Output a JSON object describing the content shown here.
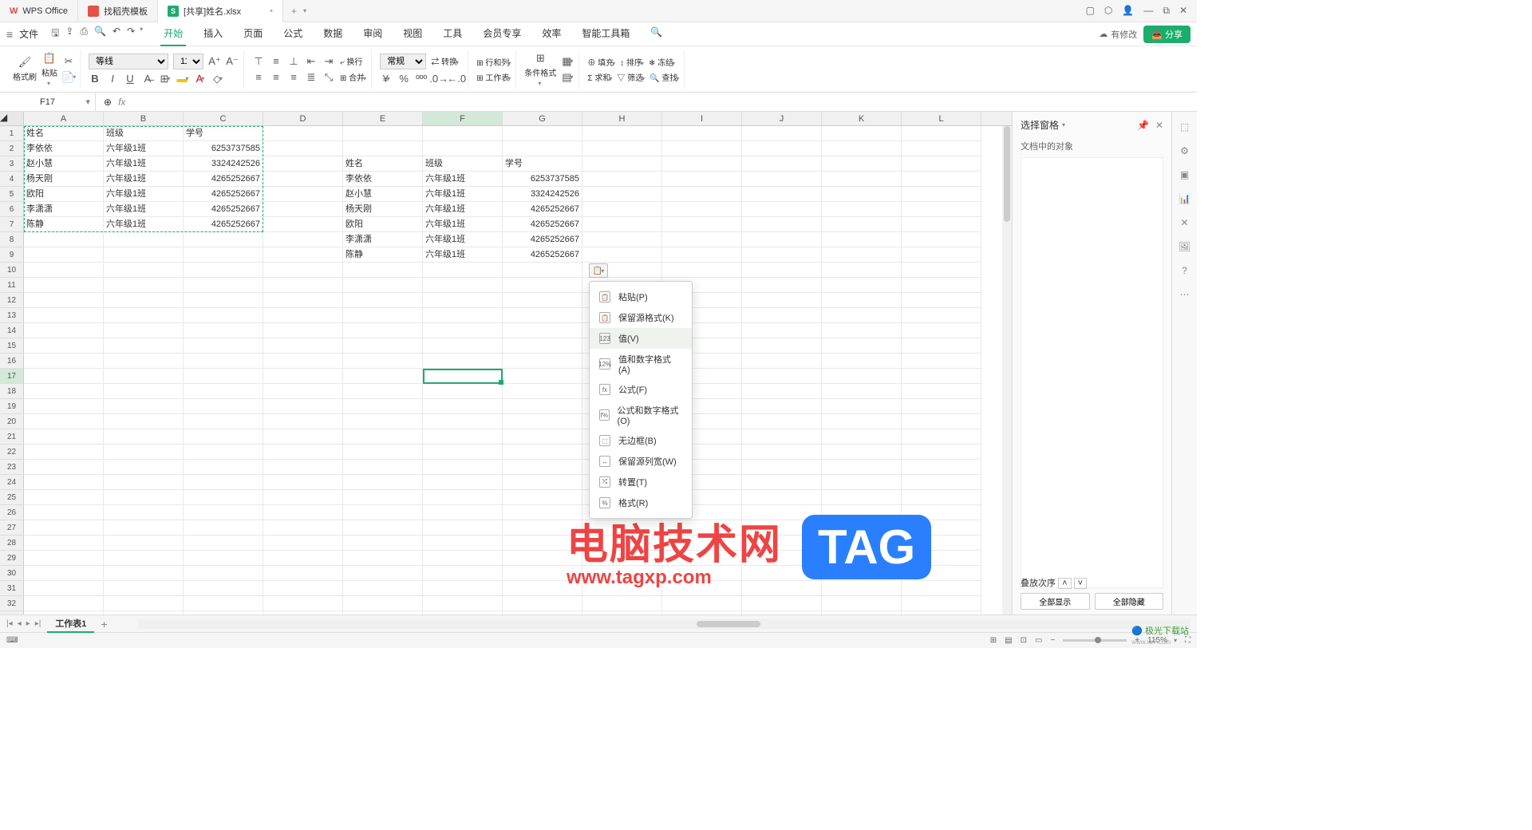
{
  "title_bar": {
    "app_name": "WPS Office",
    "template_tab": "找稻壳模板",
    "doc_tab": "[共享]姓名.xlsx",
    "add": "+"
  },
  "menu": {
    "file": "文件",
    "tabs": [
      "开始",
      "插入",
      "页面",
      "公式",
      "数据",
      "审阅",
      "视图",
      "工具",
      "会员专享",
      "效率",
      "智能工具箱"
    ],
    "modify": "有修改",
    "share": "分享"
  },
  "ribbon": {
    "format_brush": "格式刷",
    "paste": "粘贴",
    "font_name": "等线",
    "font_size": "11",
    "wrap": "换行",
    "merge": "合并",
    "general": "常规",
    "convert": "转换",
    "rowcol": "行和列",
    "worksheet": "工作表",
    "cond_format": "条件格式",
    "fill": "填充",
    "sort": "排序",
    "freeze": "冻结",
    "sum": "求和",
    "filter": "筛选",
    "find": "查找"
  },
  "namebox": "F17",
  "columns": [
    "A",
    "B",
    "C",
    "D",
    "E",
    "F",
    "G",
    "H",
    "I",
    "J",
    "K",
    "L"
  ],
  "data_left": {
    "header": [
      "姓名",
      "班级",
      "学号"
    ],
    "rows": [
      [
        "李依依",
        "六年级1班",
        "6253737585"
      ],
      [
        "赵小慧",
        "六年级1班",
        "3324242526"
      ],
      [
        "杨天刚",
        "六年级1班",
        "4265252667"
      ],
      [
        "欧阳",
        "六年级1班",
        "4265252667"
      ],
      [
        "李潇潇",
        "六年级1班",
        "4265252667"
      ],
      [
        "陈静",
        "六年级1班",
        "4265252667"
      ]
    ]
  },
  "data_right": {
    "header": [
      "姓名",
      "班级",
      "学号"
    ],
    "rows": [
      [
        "李依依",
        "六年级1班",
        "6253737585"
      ],
      [
        "赵小慧",
        "六年级1班",
        "3324242526"
      ],
      [
        "杨天刚",
        "六年级1班",
        "4265252667"
      ],
      [
        "欧阳",
        "六年级1班",
        "4265252667"
      ],
      [
        "李潇潇",
        "六年级1班",
        "4265252667"
      ],
      [
        "陈静",
        "六年级1班",
        "4265252667"
      ]
    ]
  },
  "context_menu": {
    "paste": "粘贴(P)",
    "keep_src_fmt": "保留源格式(K)",
    "value": "值(V)",
    "value_num_fmt": "值和数字格式(A)",
    "formula": "公式(F)",
    "formula_num_fmt": "公式和数字格式(O)",
    "no_border": "无边框(B)",
    "keep_col_width": "保留源列宽(W)",
    "transpose": "转置(T)",
    "format": "格式(R)"
  },
  "right_pane": {
    "title": "选择窗格",
    "objects": "文档中的对象",
    "stack": "叠放次序",
    "show_all": "全部显示",
    "hide_all": "全部隐藏"
  },
  "sheet": {
    "name": "工作表1"
  },
  "statusbar": {
    "zoom": "115%"
  },
  "watermark": {
    "text1": "电脑技术网",
    "url": "www.tagxp.com",
    "tag": "TAG",
    "site": "极光下载站",
    "site_url": "www.xz7.com"
  }
}
